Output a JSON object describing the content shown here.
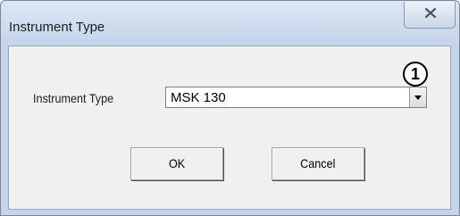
{
  "window": {
    "title": "Instrument Type"
  },
  "form": {
    "instrument_type_label": "Instrument Type",
    "instrument_type_value": "MSK 130"
  },
  "callout": {
    "number": "1"
  },
  "buttons": {
    "ok_label": "OK",
    "cancel_label": "Cancel"
  },
  "icons": {
    "close": "close-icon",
    "dropdown": "chevron-down-icon"
  },
  "colors": {
    "titlebar": "#cddbee",
    "client_background": "#f0f0f0"
  }
}
